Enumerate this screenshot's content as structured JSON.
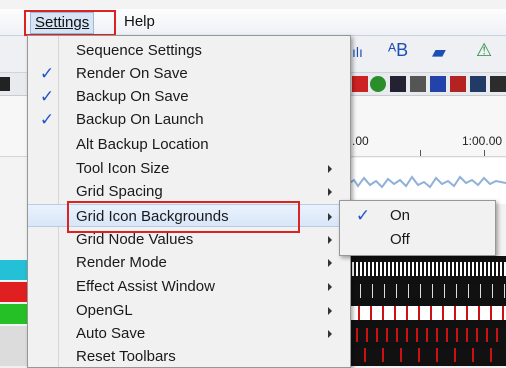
{
  "menubar": {
    "settings_label": "Settings",
    "help_label": "Help"
  },
  "timeline": {
    "tick_1": ".00",
    "tick_2": "1:00.00"
  },
  "settings_menu": {
    "items": [
      {
        "label": "Sequence Settings",
        "checked": false,
        "submenu": false
      },
      {
        "label": "Render On Save",
        "checked": true,
        "submenu": false
      },
      {
        "label": "Backup On Save",
        "checked": true,
        "submenu": false
      },
      {
        "label": "Backup On Launch",
        "checked": true,
        "submenu": false
      },
      {
        "label": "Alt Backup Location",
        "checked": false,
        "submenu": false
      },
      {
        "label": "Tool Icon Size",
        "checked": false,
        "submenu": true
      },
      {
        "label": "Grid Spacing",
        "checked": false,
        "submenu": true
      },
      {
        "label": "Grid Icon Backgrounds",
        "checked": false,
        "submenu": true
      },
      {
        "label": "Grid Node Values",
        "checked": false,
        "submenu": true
      },
      {
        "label": "Render Mode",
        "checked": false,
        "submenu": true
      },
      {
        "label": "Effect Assist Window",
        "checked": false,
        "submenu": true
      },
      {
        "label": "OpenGL",
        "checked": false,
        "submenu": true
      },
      {
        "label": "Auto Save",
        "checked": false,
        "submenu": true
      },
      {
        "label": "Reset Toolbars",
        "checked": false,
        "submenu": false
      }
    ],
    "check_glyph": "✓"
  },
  "submenu": {
    "on_label": "On",
    "off_label": "Off",
    "on_checked": true
  },
  "colors": {
    "highlight_box": "#dd2222",
    "check": "#1f55c8"
  }
}
